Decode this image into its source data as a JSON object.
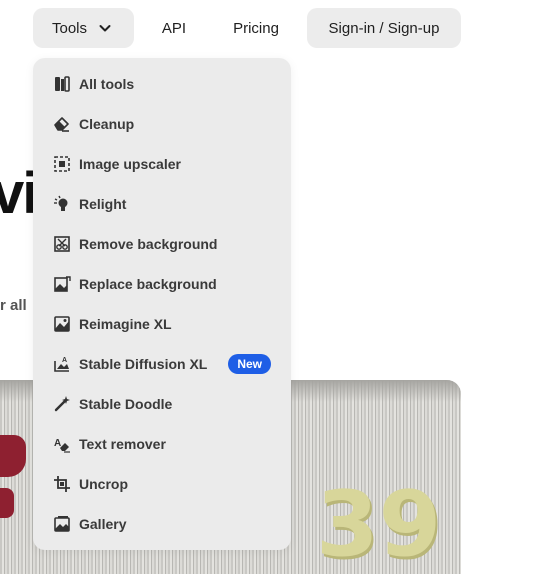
{
  "nav": {
    "tools_label": "Tools",
    "api_label": "API",
    "pricing_label": "Pricing",
    "signin_label": "Sign-in / Sign-up"
  },
  "hero": {
    "title_fragment": "vi",
    "subtitle_fragment": "r all"
  },
  "image": {
    "number_text": "39"
  },
  "menu": {
    "items": [
      {
        "label": "All tools",
        "icon": "all-tools-icon"
      },
      {
        "label": "Cleanup",
        "icon": "eraser-icon"
      },
      {
        "label": "Image upscaler",
        "icon": "upscale-icon"
      },
      {
        "label": "Relight",
        "icon": "lightbulb-icon"
      },
      {
        "label": "Remove background",
        "icon": "remove-background-icon"
      },
      {
        "label": "Replace background",
        "icon": "replace-background-icon"
      },
      {
        "label": "Reimagine XL",
        "icon": "image-icon"
      },
      {
        "label": "Stable Diffusion XL",
        "icon": "text-to-image-icon",
        "badge": "New"
      },
      {
        "label": "Stable Doodle",
        "icon": "magic-wand-icon"
      },
      {
        "label": "Text remover",
        "icon": "text-remove-icon"
      },
      {
        "label": "Uncrop",
        "icon": "crop-icon"
      },
      {
        "label": "Gallery",
        "icon": "gallery-icon"
      }
    ]
  },
  "colors": {
    "badge": "#1e5ee6",
    "menu_bg": "#ebebeb",
    "button_bg": "#ececec"
  }
}
